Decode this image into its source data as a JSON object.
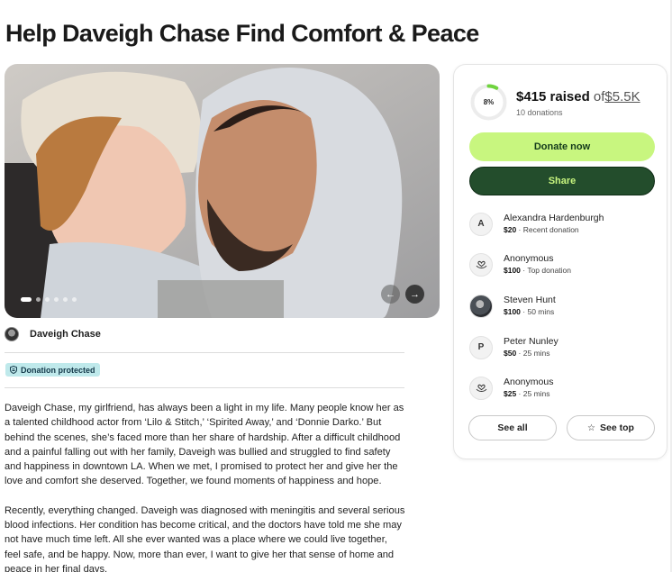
{
  "page": {
    "title": "Help Daveigh Chase Find Comfort & Peace"
  },
  "colors": {
    "donate_bg": "#c8f67f",
    "share_bg": "#234d2c",
    "protected_bg": "#bfe9eb",
    "progress_accent": "#6fd33e"
  },
  "carousel": {
    "slide_count": 6,
    "active_index": 0,
    "prev_icon": "chevron-left-icon",
    "next_icon": "chevron-right-icon"
  },
  "organizer": {
    "name": "Daveigh Chase"
  },
  "badge": {
    "label": "Donation protected",
    "icon": "shield-icon"
  },
  "story": {
    "paragraphs": [
      "Daveigh Chase, my girlfriend, has always been a light in my life. Many people know her as a talented childhood actor from ‘Lilo & Stitch,’ ‘Spirited Away,’ and ‘Donnie Darko.’ But behind the scenes, she’s faced more than her share of hardship. After a difficult childhood and a painful falling out with her family, Daveigh was bullied and struggled to find safety and happiness in downtown LA. When we met, I promised to protect her and give her the love and comfort she deserved. Together, we found moments of happiness and hope.",
      "Recently, everything changed. Daveigh was diagnosed with meningitis and several serious blood infections. Her condition has become critical, and the doctors have told me she may not have much time left. All she ever wanted was a place where we could live together, feel safe, and be happy. Now, more than ever, I want to give her that sense of home and peace in her final days."
    ]
  },
  "fundraiser": {
    "progress_label": "8%",
    "progress_fraction": 0.08,
    "raised": "$415 raised",
    "of": "of",
    "goal": "$5.5K",
    "donation_count": "10 donations",
    "donate_label": "Donate now",
    "share_label": "Share"
  },
  "donations": [
    {
      "initial": "A",
      "icon": "",
      "name": "Alexandra Hardenburgh",
      "amount": "$20",
      "note": "Recent donation"
    },
    {
      "initial": "",
      "icon": "heart-hand-icon",
      "name": "Anonymous",
      "amount": "$100",
      "note": "Top donation"
    },
    {
      "initial": "",
      "icon": "avatar-photo",
      "name": "Steven Hunt",
      "amount": "$100",
      "note": "50 mins"
    },
    {
      "initial": "P",
      "icon": "",
      "name": "Peter Nunley",
      "amount": "$50",
      "note": "25 mins"
    },
    {
      "initial": "",
      "icon": "heart-hand-icon",
      "name": "Anonymous",
      "amount": "$25",
      "note": "25 mins"
    }
  ],
  "actions": {
    "see_all": "See all",
    "see_top": "See top"
  }
}
